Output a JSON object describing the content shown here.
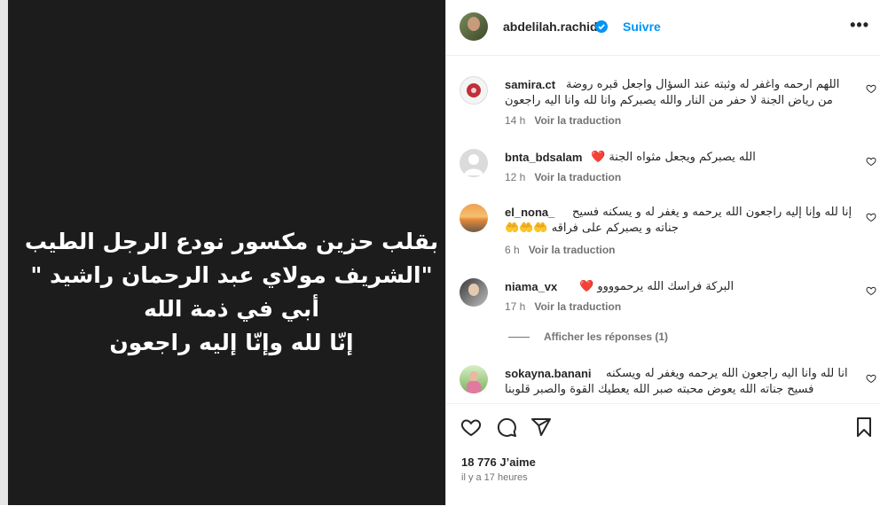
{
  "post": {
    "lines": [
      "بقلب حزين مكسور نودع الرجل الطيب",
      "\"الشريف مولاي عبد الرحمان راشيد \"",
      "أبي في ذمة الله",
      "إنّا لله وإنّا إليه راجعون"
    ]
  },
  "header": {
    "username": "abdelilah.rachid",
    "follow_label": "Suivre",
    "more_label": "•••"
  },
  "translate_label": "Voir la traduction",
  "comments": [
    {
      "username": "samira.ct",
      "text_line1": "اللهم ارحمه واغفر له وثبته عند السؤال واجعل قبره روضة",
      "text_line2": "من رياض الجنة لا حفر من النار والله يصبركم وانا لله وانا اليه راجعون",
      "time": "14 h"
    },
    {
      "username": "bnta_bdsalam",
      "text_line1": "الله يصبركم ويجعل مثواه الجنة ❤️",
      "time": "12 h"
    },
    {
      "username": "el_nona_",
      "text_line1": "إنا لله وإنا إليه راجعون الله يرحمه و يغفر له و يسكنه فسيح",
      "text_line2": "جناته و يصبركم على فراقه 🤲🤲🤲",
      "time": "6 h"
    },
    {
      "username": "niama_vx",
      "text_line1": "البركة فراسك الله يرحموووو ❤️",
      "time": "17 h"
    },
    {
      "username": "sokayna.banani",
      "text_line1": "انا لله وانا اليه راجعون الله يرحمه ويغفر له ويسكنه",
      "text_line2": "فسيح جناته الله يعوض محبته صبر الله يعطيك القوة والصبر قلوبنا"
    }
  ],
  "replies_label": "Afficher les réponses (1)",
  "actions": {
    "likes": "18 776 J’aime",
    "time": "il y a 17 heures"
  },
  "colors": {
    "accent": "#0095f6",
    "verified": "#0095f6",
    "dark_bg": "#1c1c1c"
  }
}
